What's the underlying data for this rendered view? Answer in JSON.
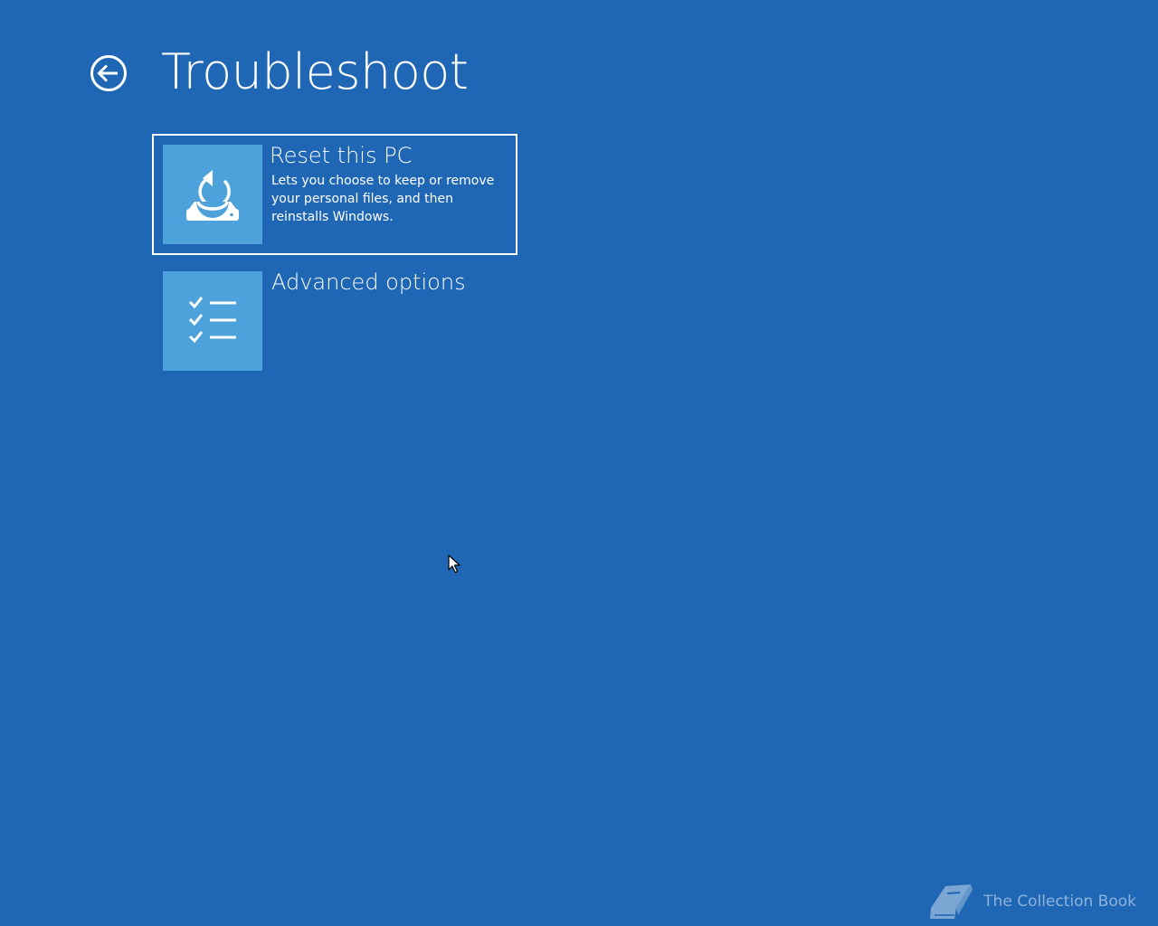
{
  "page": {
    "title": "Troubleshoot",
    "background_color": "#1f67b4"
  },
  "back_button": {
    "icon": "back-arrow-circle-icon"
  },
  "options": [
    {
      "title": "Reset this PC",
      "description": "Lets you choose to keep or remove your personal files, and then reinstalls Windows.",
      "icon": "reset-pc-icon",
      "selected": true
    },
    {
      "title": "Advanced options",
      "icon": "checklist-icon",
      "selected": false
    }
  ],
  "tile_color": "#4ea2dc",
  "watermark": {
    "text": "The Collection Book",
    "icon": "book-icon"
  }
}
